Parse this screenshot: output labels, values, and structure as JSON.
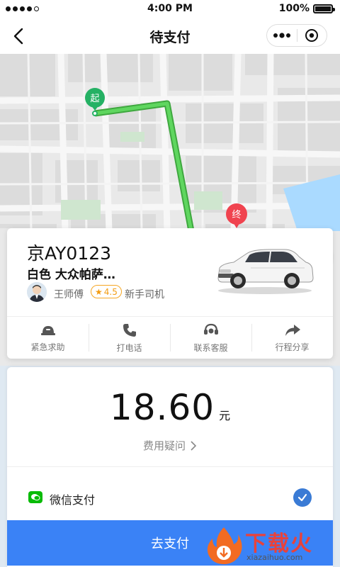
{
  "status_bar": {
    "time": "4:00 PM",
    "battery": "100%",
    "signal_bars_on": 4,
    "signal_bars_total": 5
  },
  "nav": {
    "title": "待支付",
    "back_icon": "chevron-left-icon",
    "more_icon": "more-dots-icon",
    "close_icon": "target-close-icon"
  },
  "map": {
    "start_label": "起",
    "end_label": "终",
    "route_color": "#4cc94c",
    "start_color": "#25b164",
    "end_color": "#f0434f",
    "locate_icon": "crosshair-icon"
  },
  "driver": {
    "plate": "京AY0123",
    "car_description": "白色 大众帕萨…",
    "name": "王师傅",
    "rating": "4.5",
    "tag": "新手司机",
    "actions": [
      {
        "label": "紧急求助",
        "icon": "emergency-siren-icon"
      },
      {
        "label": "打电话",
        "icon": "phone-icon"
      },
      {
        "label": "联系客服",
        "icon": "customer-service-icon"
      },
      {
        "label": "行程分享",
        "icon": "share-arrow-icon"
      }
    ]
  },
  "payment": {
    "amount": "18.60",
    "unit": "元",
    "fee_query_label": "费用疑问",
    "method_label": "微信支付",
    "pay_button_label": "去支付",
    "accent_color": "#3a82f6"
  },
  "watermark": {
    "text": "下载火",
    "url": "xiazaihuo.com"
  }
}
